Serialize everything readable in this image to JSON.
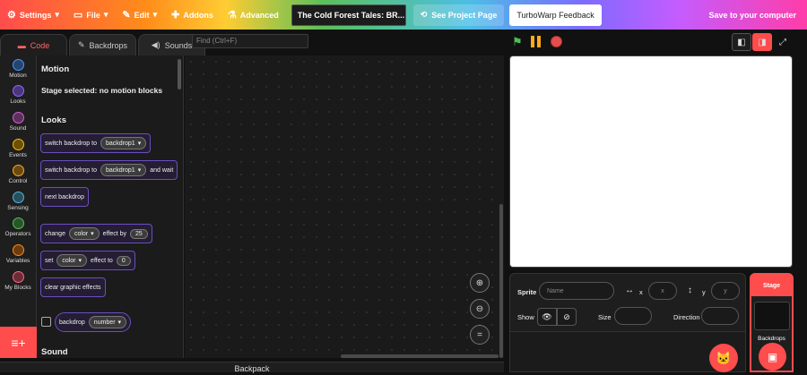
{
  "menubar": {
    "settings": "Settings",
    "file": "File",
    "edit": "Edit",
    "addons": "Addons",
    "advanced": "Advanced",
    "project_title": "The Cold Forest Tales: BR...",
    "see_project": "See Project Page",
    "feedback": "TurboWarp Feedback",
    "save": "Save to your computer"
  },
  "tabs": {
    "code": "Code",
    "backdrops": "Backdrops",
    "sounds": "Sounds"
  },
  "find": {
    "placeholder": "Find (Ctrl+F)"
  },
  "categories": [
    {
      "label": "Motion",
      "color": "#4c97ff"
    },
    {
      "label": "Looks",
      "color": "#9966ff"
    },
    {
      "label": "Sound",
      "color": "#cf63cf"
    },
    {
      "label": "Events",
      "color": "#ffbf00"
    },
    {
      "label": "Control",
      "color": "#ffab19"
    },
    {
      "label": "Sensing",
      "color": "#5cb1d6"
    },
    {
      "label": "Operators",
      "color": "#59c059"
    },
    {
      "label": "Variables",
      "color": "#ff8c1a"
    },
    {
      "label": "My Blocks",
      "color": "#ff6680"
    }
  ],
  "palette": {
    "motion_heading": "Motion",
    "motion_note": "Stage selected: no motion blocks",
    "looks_heading": "Looks",
    "switch_backdrop_to": "switch backdrop to",
    "backdrop1": "backdrop1",
    "and_wait": "and wait",
    "next_backdrop": "next backdrop",
    "change": "change",
    "color": "color",
    "effect_by": "effect by",
    "val_25": "25",
    "set": "set",
    "effect_to": "effect to",
    "val_0": "0",
    "clear_effects": "clear graphic effects",
    "backdrop": "backdrop",
    "number": "number",
    "sound_heading": "Sound"
  },
  "backpack": "Backpack",
  "sprite_info": {
    "sprite_label": "Sprite",
    "name_placeholder": "Name",
    "x_label": "x",
    "x_placeholder": "x",
    "y_label": "y",
    "y_placeholder": "y",
    "show_label": "Show",
    "size_label": "Size",
    "direction_label": "Direction"
  },
  "stage_pane": {
    "title": "Stage",
    "backdrops": "Backdrops"
  },
  "colors": {
    "accent": "#ff4c4c",
    "looks": "#9966ff"
  }
}
